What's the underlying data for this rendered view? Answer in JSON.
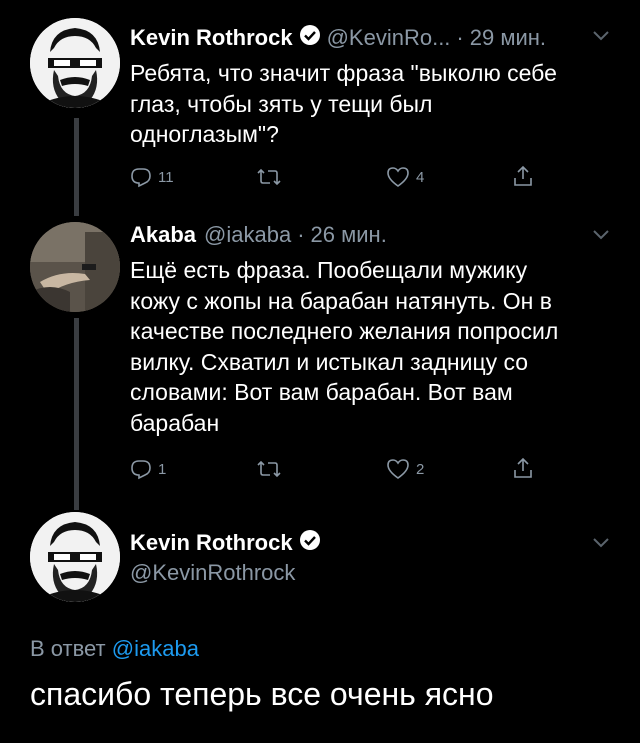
{
  "tweets": [
    {
      "name": "Kevin Rothrock",
      "handle": "@KevinRo...",
      "separator": "·",
      "time": "29 мин.",
      "lines": [
        "Ребята, что значит фраза \"выколю себе",
        "глаз, чтобы зять у тещи был",
        "одноглазым\"?"
      ],
      "replies": "11",
      "retweets": "",
      "likes": "4"
    },
    {
      "name": "Akaba",
      "handle": "@iakaba",
      "separator": "·",
      "time": "26 мин.",
      "lines": [
        "Ещё есть фраза. Пообещали мужику",
        "кожу с жопы на барабан натянуть. Он в",
        "качестве последнего желания попросил",
        "вилку. Схватил и истыкал задницу со",
        "словами: Вот вам барабан. Вот вам",
        "барабан"
      ],
      "replies": "1",
      "retweets": "",
      "likes": "2"
    }
  ],
  "main_tweet": {
    "name": "Kevin Rothrock",
    "handle": "@KevinRothrock",
    "reply_prefix": "В ответ",
    "reply_to": "@iakaba",
    "text": "спасибо теперь все очень ясно"
  },
  "colors": {
    "background": "#000000",
    "text": "#ffffff",
    "secondary": "#8b98a5",
    "link": "#1d9bf0",
    "thread_line": "#3a3d41"
  },
  "icons": [
    "reply-icon",
    "retweet-icon",
    "like-icon",
    "share-icon",
    "chevron-down-icon",
    "verified-badge-icon"
  ]
}
